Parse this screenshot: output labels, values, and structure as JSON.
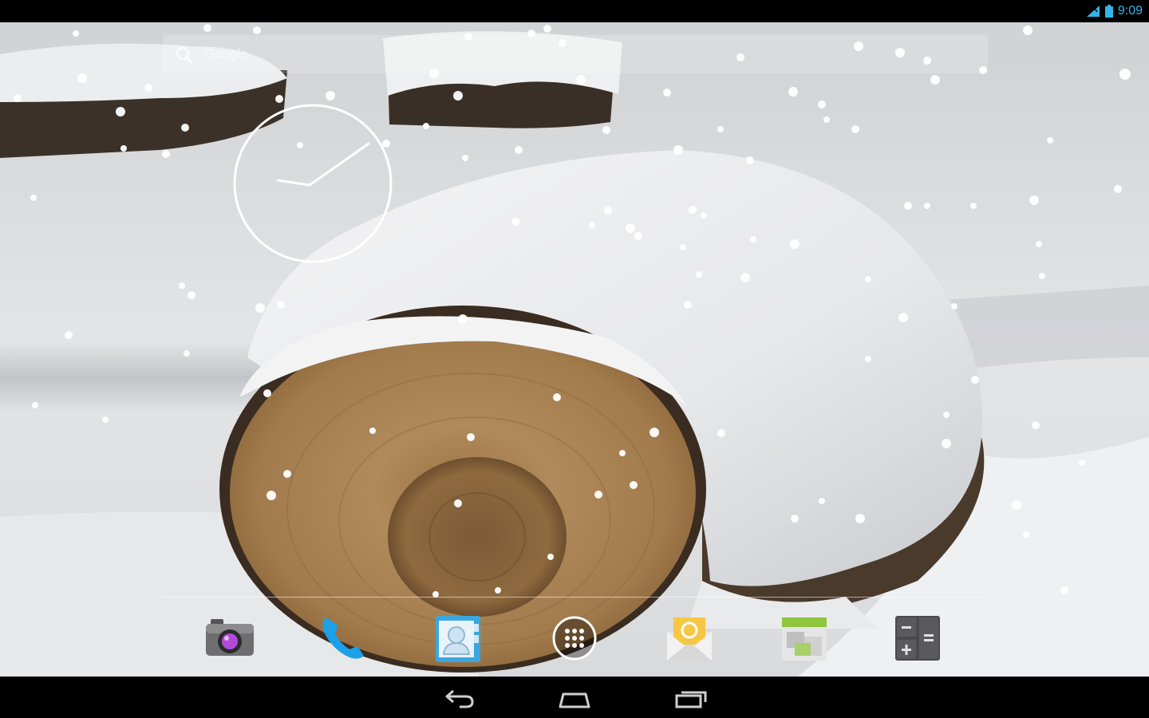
{
  "status_bar": {
    "time": "9:09",
    "time_color": "#33b5e5",
    "signal_icon": "signal-icon",
    "battery_icon": "battery-icon"
  },
  "search": {
    "label": "Google",
    "icon": "search-icon"
  },
  "clock": {
    "icon": "analog-clock-widget"
  },
  "dock": {
    "items": [
      {
        "name": "camera",
        "icon": "camera-icon"
      },
      {
        "name": "phone",
        "icon": "phone-icon"
      },
      {
        "name": "contacts",
        "icon": "contacts-icon"
      },
      {
        "name": "all-apps",
        "icon": "app-drawer-icon"
      },
      {
        "name": "email",
        "icon": "email-icon"
      },
      {
        "name": "gallery",
        "icon": "gallery-icon"
      },
      {
        "name": "calculator",
        "icon": "calculator-icon"
      }
    ]
  },
  "nav_bar": {
    "buttons": [
      "back-icon",
      "home-icon",
      "recent-apps-icon"
    ]
  },
  "colors": {
    "accent": "#33b5e5",
    "snow": "#e9eaec",
    "wood": "#a67e4f",
    "bark": "#3a2c20"
  }
}
